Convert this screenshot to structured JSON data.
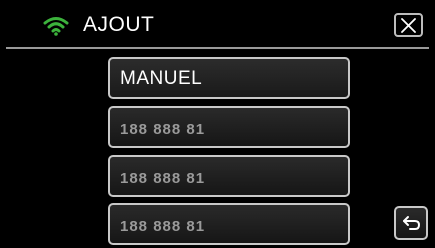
{
  "header": {
    "title": "AJOUT",
    "wifi_icon": "wifi-icon",
    "close_icon": "close-icon",
    "accent_color": "#3cb23c"
  },
  "list": {
    "items": [
      {
        "label": "MANUEL"
      },
      {
        "label": "188 888 81"
      },
      {
        "label": "188 888 81"
      },
      {
        "label": "188 888 81"
      }
    ]
  },
  "footer": {
    "back_icon": "back-arrow-icon"
  }
}
